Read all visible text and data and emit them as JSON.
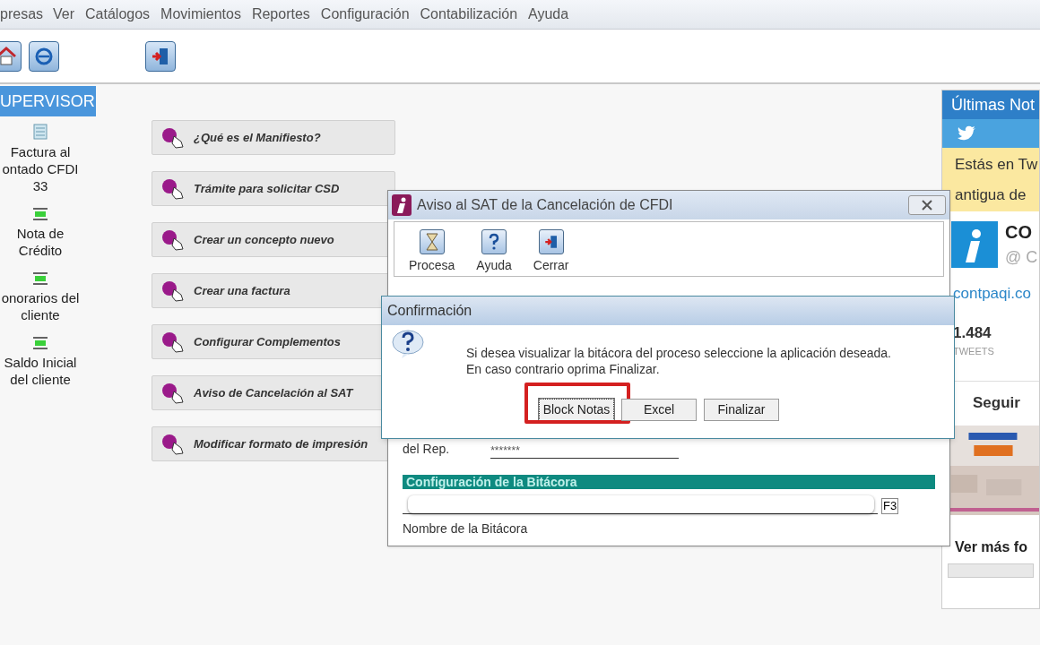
{
  "menu": [
    "presas",
    "Ver",
    "Catálogos",
    "Movimientos",
    "Reportes",
    "Configuración",
    "Contabilización",
    "Ayuda"
  ],
  "toolbar": [
    {
      "kind": "home"
    },
    {
      "kind": "web"
    },
    {
      "kind": "exit"
    }
  ],
  "sidebar": {
    "title": "UPERVISOR",
    "items": [
      {
        "kind": "invoice",
        "label": "Factura al\nontado CFDI\n33"
      },
      {
        "kind": "doc",
        "label": "Nota de\nCrédito"
      },
      {
        "kind": "doc",
        "label": "onorarios del\ncliente"
      },
      {
        "kind": "doc",
        "label": "Saldo Inicial\ndel cliente"
      }
    ]
  },
  "links": [
    "¿Qué es el Manifiesto?",
    "Trámite para solicitar CSD",
    "Crear un concepto nuevo",
    "Crear una factura",
    "Configurar Complementos",
    "Aviso de Cancelación al SAT",
    "Modificar formato de impresión"
  ],
  "news": {
    "title": "Últimas Not",
    "notice": [
      "Estás en Tw",
      "antigua de"
    ],
    "account": "CO",
    "handle": "@ C",
    "link": "contpaqi.co",
    "count": "1.484",
    "count_label": "TWEETS",
    "follow": "Seguir",
    "more": "Ver más fo"
  },
  "dialog": {
    "title": "Aviso al SAT de la Cancelación de CFDI",
    "tools": [
      {
        "kind": "process",
        "label": "Procesa"
      },
      {
        "kind": "help",
        "label": "Ayuda"
      },
      {
        "kind": "exit",
        "label": "Cerrar"
      }
    ],
    "password_label": "del Rep.",
    "password": "*******",
    "section": "Configuración de la Bitácora",
    "f3": "F3",
    "log_label": "Nombre de la Bitácora"
  },
  "confirm": {
    "title": "Confirmación",
    "message": [
      "Si desea visualizar la bitácora del proceso seleccione la aplicación deseada.",
      "En caso contrario oprima Finalizar."
    ],
    "buttons": [
      {
        "label": "Block Notas",
        "focused": true
      },
      {
        "label": "Excel",
        "focused": false
      },
      {
        "label": "Finalizar",
        "focused": false
      }
    ]
  }
}
